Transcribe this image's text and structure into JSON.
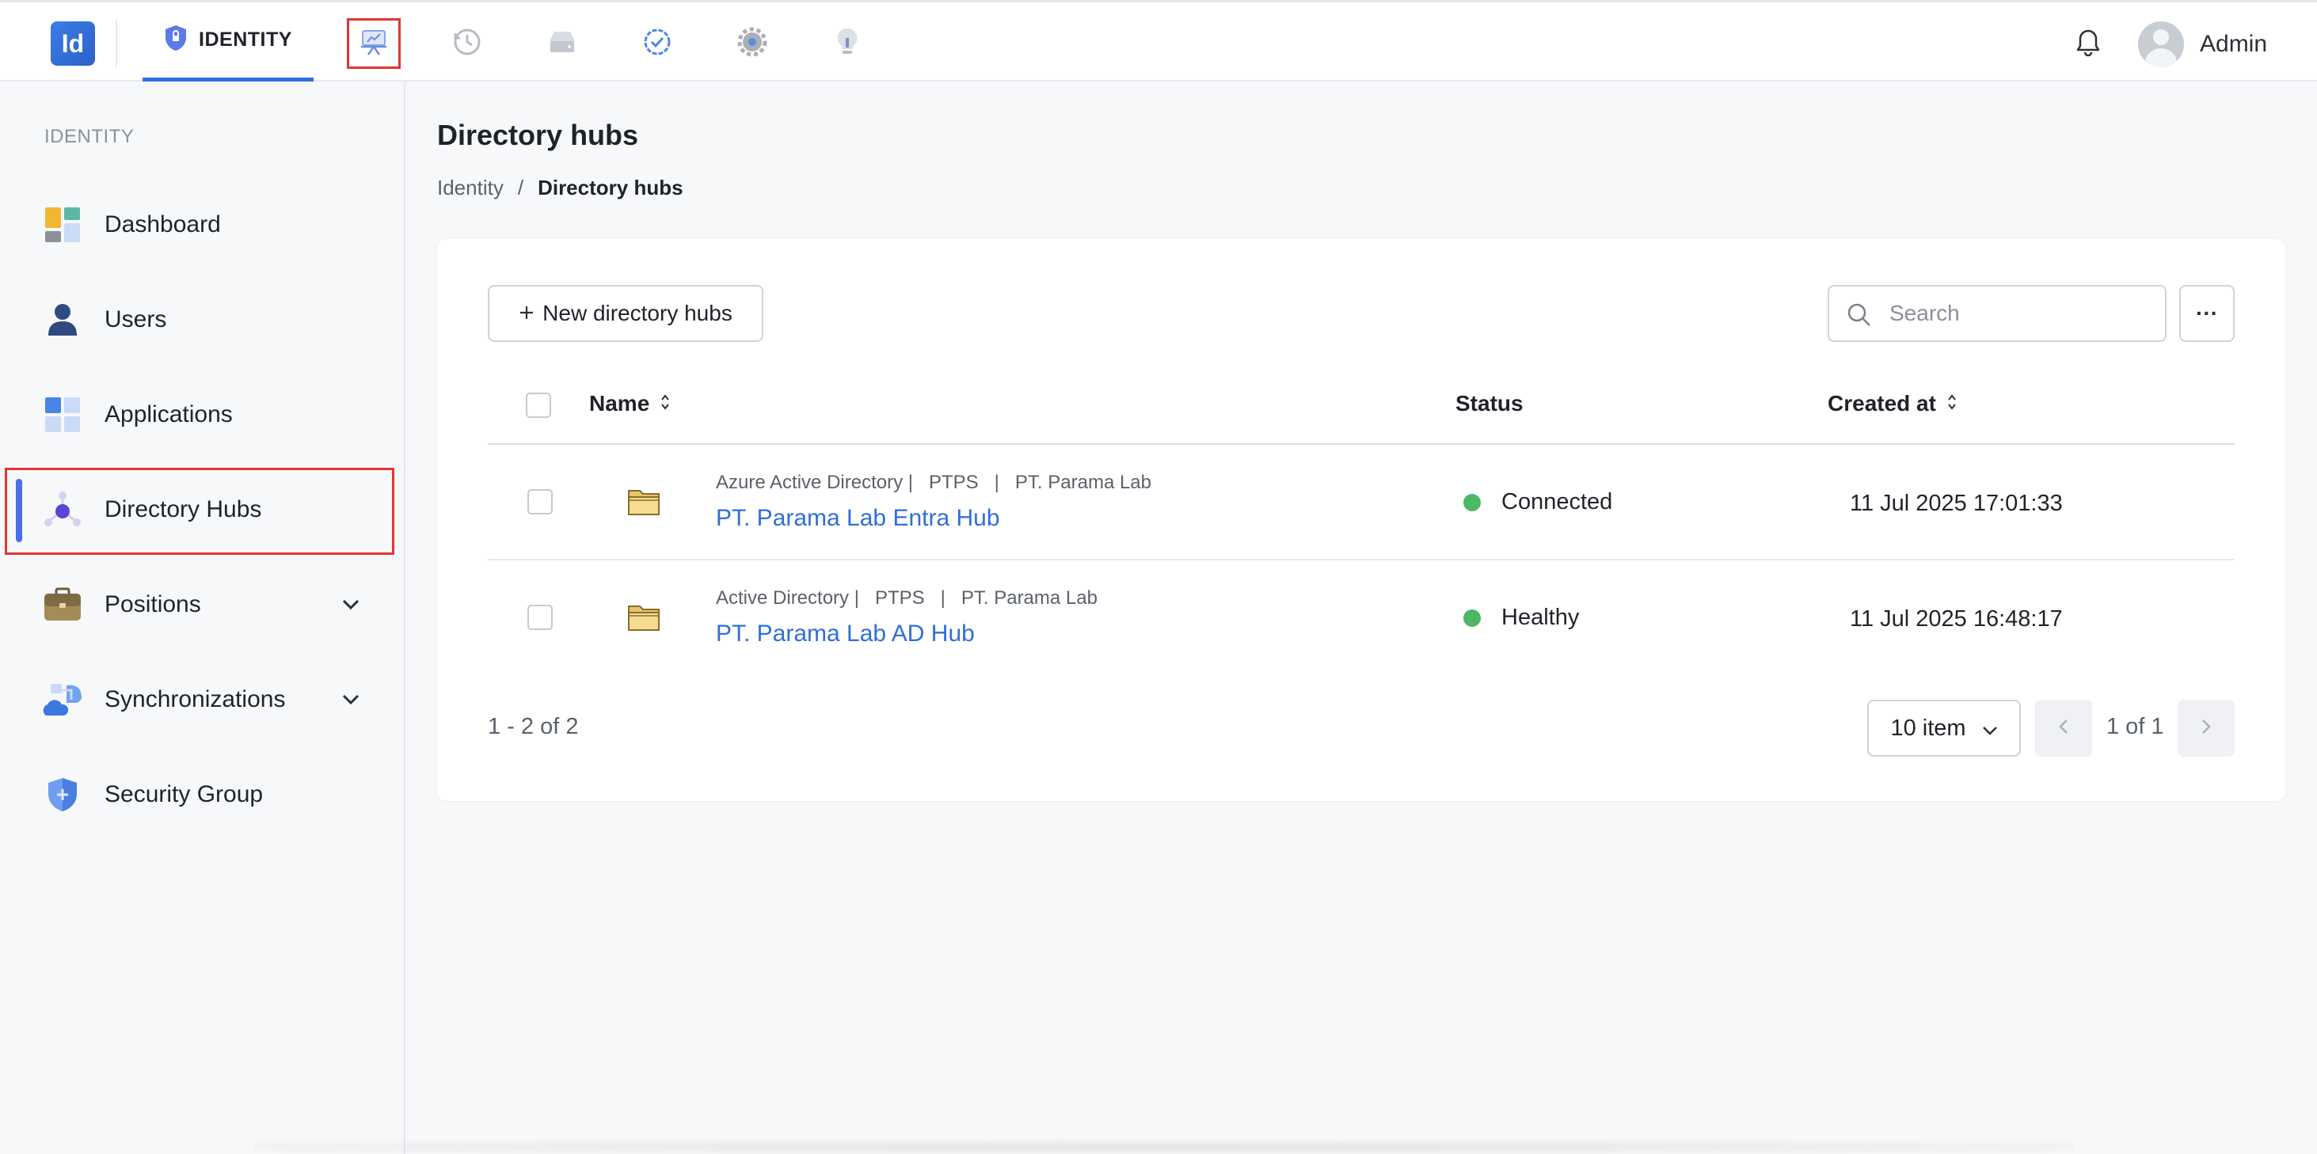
{
  "topbar": {
    "logo_text": "Id",
    "active_app_label": "IDENTITY",
    "app_icons": [
      "reports-icon",
      "history-icon",
      "storage-icon",
      "verified-icon",
      "settings-icon",
      "lightbulb-icon"
    ],
    "user_name": "Admin"
  },
  "sidebar": {
    "section_label": "IDENTITY",
    "items": [
      {
        "label": "Dashboard",
        "icon": "dashboard-icon"
      },
      {
        "label": "Users",
        "icon": "user-icon"
      },
      {
        "label": "Applications",
        "icon": "applications-icon"
      },
      {
        "label": "Directory Hubs",
        "icon": "directory-hub-icon",
        "active": true
      },
      {
        "label": "Positions",
        "icon": "briefcase-icon",
        "expandable": true
      },
      {
        "label": "Synchronizations",
        "icon": "cloud-sync-icon",
        "expandable": true
      },
      {
        "label": "Security Group",
        "icon": "shield-icon"
      }
    ]
  },
  "main": {
    "title": "Directory hubs",
    "breadcrumb": {
      "root": "Identity",
      "separator": "/",
      "current": "Directory hubs"
    },
    "new_button_label": "New directory hubs",
    "search_placeholder": "Search",
    "more_label": "···",
    "table": {
      "columns": {
        "name": "Name",
        "status": "Status",
        "created": "Created at"
      },
      "rows": [
        {
          "meta": "Azure Active Directory |   PTPS   |   PT. Parama Lab",
          "name": "PT. Parama Lab Entra Hub",
          "status": "Connected",
          "created": "11 Jul 2025 17:01:33"
        },
        {
          "meta": "Active Directory |   PTPS   |   PT. Parama Lab",
          "name": "PT. Parama Lab AD Hub",
          "status": "Healthy",
          "created": "11 Jul 2025 16:48:17"
        }
      ]
    },
    "pagination": {
      "range": "1 - 2 of 2",
      "page_size": "10 item",
      "page_label": "1 of 1"
    }
  },
  "colors": {
    "accent": "#2f6fe0",
    "link": "#2f6fd8",
    "status_ok": "#4cb865",
    "highlight_frame": "#e0362f"
  }
}
